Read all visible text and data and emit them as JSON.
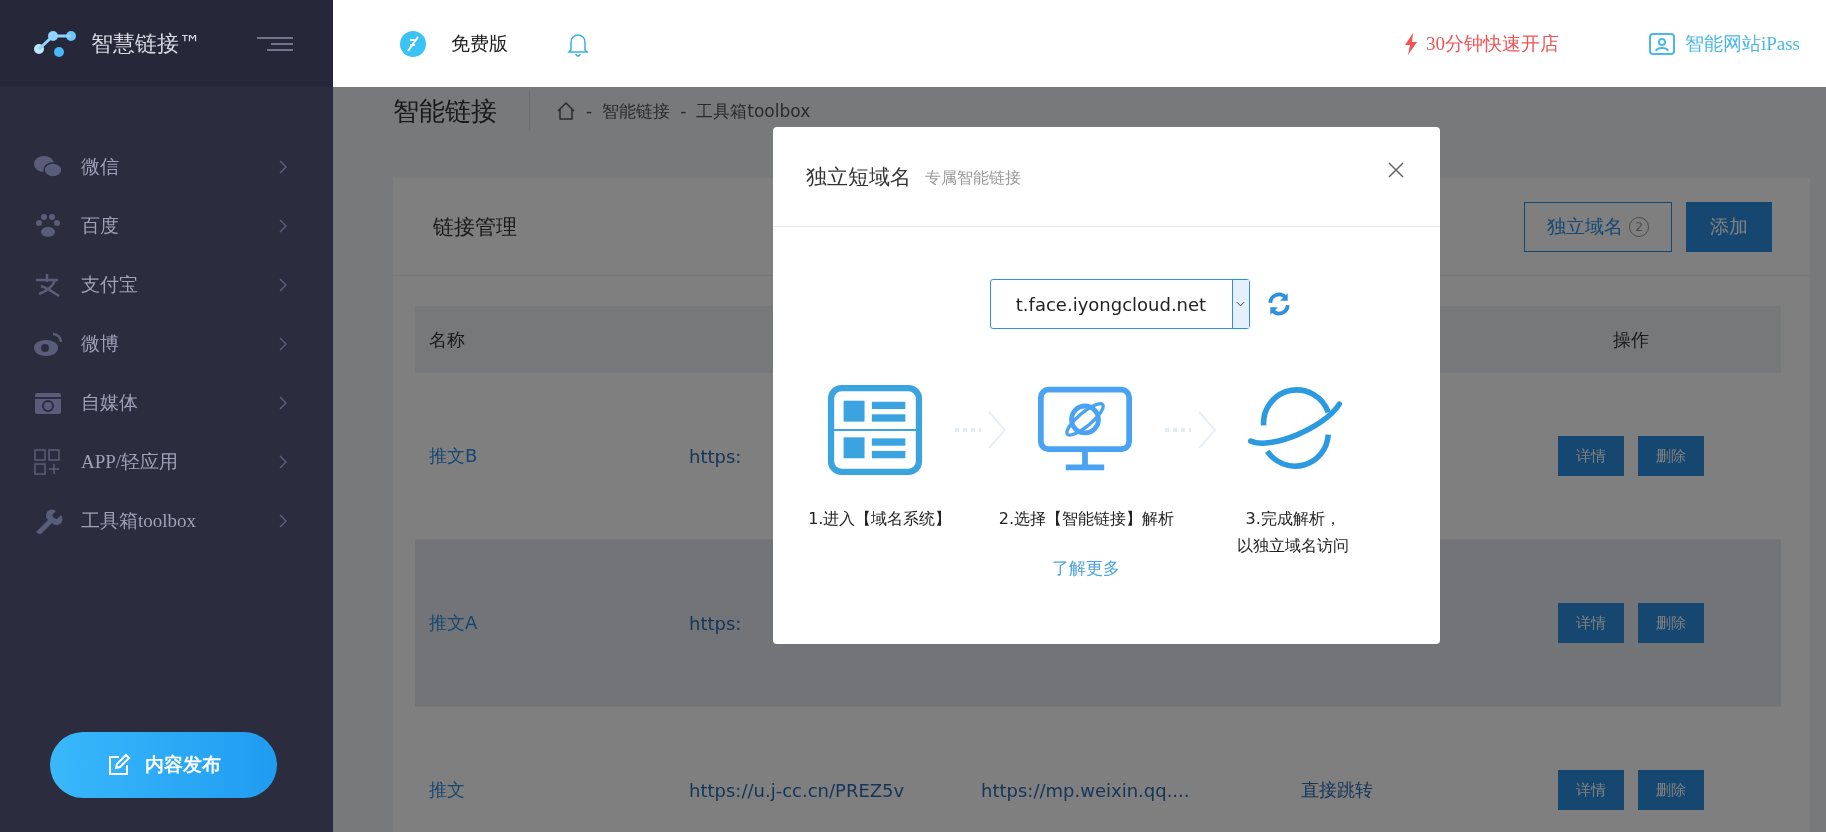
{
  "sidebar": {
    "brand": "智慧链接™",
    "items": [
      {
        "label": "微信"
      },
      {
        "label": "百度"
      },
      {
        "label": "支付宝"
      },
      {
        "label": "微博"
      },
      {
        "label": "自媒体"
      },
      {
        "label": "APP/轻应用"
      },
      {
        "label": "工具箱toolbox"
      }
    ],
    "publish_button": "内容发布"
  },
  "header": {
    "plan": "免费版",
    "promo": "30分钟快速开店",
    "site_link": "智能网站iPass"
  },
  "page": {
    "title": "智能链接",
    "breadcrumb": [
      {
        "separator": "-",
        "label": "智能链接"
      },
      {
        "separator": "-",
        "label": "工具箱toolbox"
      }
    ]
  },
  "card": {
    "title": "链接管理",
    "domain_button": {
      "label": "独立域名",
      "count": "2"
    },
    "add_button": "添加"
  },
  "table": {
    "columns": [
      {
        "label": "名称",
        "kind": "name"
      },
      {
        "label": "操作",
        "kind": "actions"
      }
    ],
    "rows": [
      {
        "name": "推文B",
        "short_url": "https:",
        "selected": false,
        "actions": [
          "详情",
          "删除"
        ]
      },
      {
        "name": "推文A",
        "short_url": "https:",
        "selected": true,
        "actions": [
          "详情",
          "删除"
        ]
      },
      {
        "name": "推文",
        "short_url": "https://u.j-cc.cn/PREZ5v",
        "target_url": "https://mp.weixin.qq....",
        "type": "直接跳转",
        "selected": false,
        "actions": [
          "详情",
          "删除"
        ]
      }
    ]
  },
  "modal": {
    "title": "独立短域名",
    "subtitle": "专属智能链接",
    "domain_select": {
      "value": "t.face.iyongcloud.net"
    },
    "steps": [
      {
        "lines": [
          "1.进入【域名系统】"
        ]
      },
      {
        "lines": [
          "2.选择【智能链接】解析"
        ]
      },
      {
        "lines": [
          "3.完成解析，",
          "以独立域名访问"
        ]
      }
    ],
    "more_link": "了解更多"
  }
}
